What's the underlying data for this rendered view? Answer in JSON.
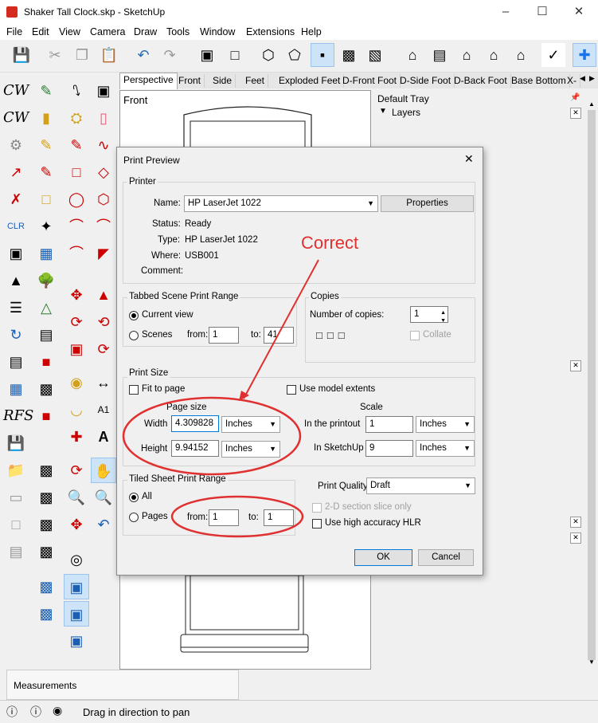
{
  "window": {
    "title": "Shaker Tall Clock.skp - SketchUp"
  },
  "menu": [
    "File",
    "Edit",
    "View",
    "Camera",
    "Draw",
    "Tools",
    "Window",
    "Extensions",
    "Help"
  ],
  "scene_tabs": [
    "Perspective",
    "Front",
    "Side",
    "Feet",
    "Exploded Feet",
    "D-Front Foot",
    "D-Side Foot",
    "D-Back Foot",
    "Base Bottom",
    "X-"
  ],
  "viewport": {
    "label": "Front"
  },
  "tray": {
    "title": "Default Tray",
    "panel": "Layers"
  },
  "measurements": {
    "label": "Measurements"
  },
  "status": {
    "hint": "Drag in direction to pan"
  },
  "dialog": {
    "title": "Print Preview",
    "printer": {
      "group": "Printer",
      "name_label": "Name:",
      "name_value": "HP LaserJet 1022",
      "properties_button": "Properties",
      "status_label": "Status:",
      "status_value": "Ready",
      "type_label": "Type:",
      "type_value": "HP LaserJet 1022",
      "where_label": "Where:",
      "where_value": "USB001",
      "comment_label": "Comment:"
    },
    "scene_range": {
      "group": "Tabbed Scene Print Range",
      "current_view": "Current view",
      "scenes": "Scenes",
      "from_label": "from:",
      "from_value": "1",
      "to_label": "to:",
      "to_value": "41"
    },
    "copies": {
      "group": "Copies",
      "number_label": "Number of copies:",
      "number_value": "1",
      "collate": "Collate"
    },
    "print_size": {
      "group": "Print Size",
      "fit_to_page": "Fit to page",
      "use_model_extents": "Use model extents",
      "page_size": "Page size",
      "scale": "Scale",
      "width_label": "Width",
      "width_value": "4.309828",
      "width_unit": "Inches",
      "height_label": "Height",
      "height_value": "9.94152",
      "height_unit": "Inches",
      "printout_label": "In the printout",
      "printout_value": "1",
      "printout_unit": "Inches",
      "sketchup_label": "In SketchUp",
      "sketchup_value": "9",
      "sketchup_unit": "Inches"
    },
    "tiled": {
      "group": "Tiled Sheet Print Range",
      "all": "All",
      "pages": "Pages",
      "from_label": "from:",
      "from_value": "1",
      "to_label": "to:",
      "to_value": "1"
    },
    "quality": {
      "label": "Print Quality",
      "value": "Draft",
      "section_slice": "2-D section slice only",
      "high_accuracy": "Use high accuracy HLR"
    },
    "ok": "OK",
    "cancel": "Cancel"
  },
  "annotation": {
    "text": "Correct",
    "color": "#e03030"
  }
}
